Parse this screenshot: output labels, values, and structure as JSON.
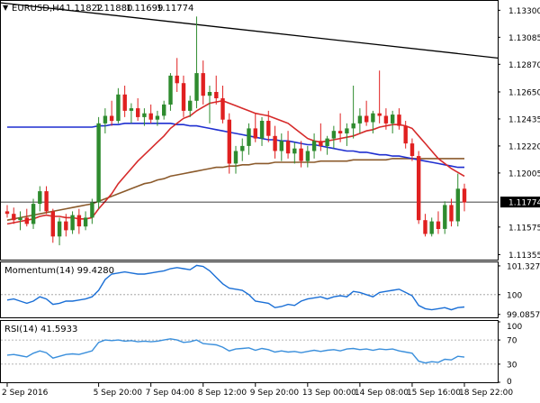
{
  "chart_data": {
    "type": "candlestick",
    "symbol_title": "EURUSD,H4",
    "ohlc": [
      "1.11822",
      "1.11880",
      "1.11699",
      "1.11774"
    ],
    "price_axis": {
      "min": 1.1133,
      "max": 1.1336,
      "ticks": [
        "1.13300",
        "1.13085",
        "1.12870",
        "1.12650",
        "1.12435",
        "1.12220",
        "1.12005",
        "1.11575",
        "1.11355"
      ],
      "current_price": 1.11774,
      "current_price_label": "1.11774"
    },
    "time_axis": {
      "labels": [
        {
          "text": "2 Sep 2016",
          "index": 0
        },
        {
          "text": "5 Sep 20:00",
          "index": 14
        },
        {
          "text": "7 Sep 04:00",
          "index": 22
        },
        {
          "text": "8 Sep 12:00",
          "index": 30
        },
        {
          "text": "9 Sep 20:00",
          "index": 38
        },
        {
          "text": "13 Sep 00:00",
          "index": 46
        },
        {
          "text": "14 Sep 08:00",
          "index": 54
        },
        {
          "text": "15 Sep 16:00",
          "index": 62
        },
        {
          "text": "18 Sep 22:00",
          "index": 70
        }
      ]
    },
    "candles": [
      [
        1.117,
        1.1175,
        1.1165,
        1.1168
      ],
      [
        1.1168,
        1.1173,
        1.116,
        1.1163
      ],
      [
        1.1163,
        1.117,
        1.1155,
        1.1165
      ],
      [
        1.1165,
        1.1172,
        1.1158,
        1.116
      ],
      [
        1.116,
        1.118,
        1.1156,
        1.1176
      ],
      [
        1.1176,
        1.119,
        1.117,
        1.1186
      ],
      [
        1.1186,
        1.119,
        1.1168,
        1.117
      ],
      [
        1.117,
        1.1172,
        1.1145,
        1.115
      ],
      [
        1.115,
        1.1165,
        1.1143,
        1.1162
      ],
      [
        1.1162,
        1.1168,
        1.115,
        1.1155
      ],
      [
        1.1155,
        1.117,
        1.1152,
        1.1167
      ],
      [
        1.1167,
        1.1172,
        1.1152,
        1.1158
      ],
      [
        1.1158,
        1.117,
        1.1155,
        1.1165
      ],
      [
        1.1165,
        1.118,
        1.116,
        1.1177
      ],
      [
        1.1177,
        1.1245,
        1.1172,
        1.124
      ],
      [
        1.124,
        1.1252,
        1.1232,
        1.1246
      ],
      [
        1.1246,
        1.1258,
        1.1238,
        1.1242
      ],
      [
        1.1242,
        1.1268,
        1.124,
        1.1263
      ],
      [
        1.1263,
        1.127,
        1.1245,
        1.125
      ],
      [
        1.125,
        1.1256,
        1.124,
        1.1252
      ],
      [
        1.1252,
        1.126,
        1.1242,
        1.1245
      ],
      [
        1.1245,
        1.1252,
        1.1238,
        1.1248
      ],
      [
        1.1248,
        1.1255,
        1.124,
        1.1243
      ],
      [
        1.1243,
        1.125,
        1.1238,
        1.1246
      ],
      [
        1.1246,
        1.1258,
        1.1243,
        1.1255
      ],
      [
        1.1255,
        1.128,
        1.125,
        1.1278
      ],
      [
        1.1278,
        1.1292,
        1.1265,
        1.1272
      ],
      [
        1.1272,
        1.1278,
        1.1245,
        1.125
      ],
      [
        1.125,
        1.1262,
        1.1245,
        1.1258
      ],
      [
        1.1258,
        1.1325,
        1.1252,
        1.128
      ],
      [
        1.128,
        1.129,
        1.1255,
        1.1262
      ],
      [
        1.1262,
        1.127,
        1.124,
        1.1265
      ],
      [
        1.1265,
        1.1278,
        1.1255,
        1.126
      ],
      [
        1.126,
        1.127,
        1.124,
        1.1243
      ],
      [
        1.1243,
        1.1248,
        1.12,
        1.1208
      ],
      [
        1.1208,
        1.1222,
        1.12,
        1.1218
      ],
      [
        1.1218,
        1.1228,
        1.121,
        1.1222
      ],
      [
        1.1222,
        1.124,
        1.1215,
        1.1236
      ],
      [
        1.1236,
        1.1248,
        1.1225,
        1.1228
      ],
      [
        1.1228,
        1.1245,
        1.1222,
        1.1242
      ],
      [
        1.1242,
        1.125,
        1.1225,
        1.123
      ],
      [
        1.123,
        1.1238,
        1.1212,
        1.1218
      ],
      [
        1.1218,
        1.1232,
        1.121,
        1.1226
      ],
      [
        1.1226,
        1.1234,
        1.1212,
        1.1216
      ],
      [
        1.1216,
        1.1225,
        1.1208,
        1.122
      ],
      [
        1.122,
        1.1226,
        1.1205,
        1.121
      ],
      [
        1.121,
        1.1222,
        1.1205,
        1.1218
      ],
      [
        1.1218,
        1.1232,
        1.1212,
        1.1226
      ],
      [
        1.1226,
        1.124,
        1.1218,
        1.1222
      ],
      [
        1.1222,
        1.123,
        1.1215,
        1.1228
      ],
      [
        1.1228,
        1.1238,
        1.122,
        1.1234
      ],
      [
        1.1234,
        1.1248,
        1.1225,
        1.1232
      ],
      [
        1.1232,
        1.124,
        1.1222,
        1.1236
      ],
      [
        1.1236,
        1.127,
        1.1228,
        1.124
      ],
      [
        1.124,
        1.1252,
        1.1232,
        1.1246
      ],
      [
        1.1246,
        1.1258,
        1.1238,
        1.1241
      ],
      [
        1.1241,
        1.125,
        1.1232,
        1.1248
      ],
      [
        1.1248,
        1.1282,
        1.124,
        1.1246
      ],
      [
        1.1246,
        1.1252,
        1.1235,
        1.124
      ],
      [
        1.124,
        1.125,
        1.1232,
        1.1247
      ],
      [
        1.1247,
        1.1252,
        1.1235,
        1.1238
      ],
      [
        1.1238,
        1.1242,
        1.122,
        1.1224
      ],
      [
        1.1224,
        1.1228,
        1.121,
        1.1214
      ],
      [
        1.1214,
        1.1218,
        1.116,
        1.1163
      ],
      [
        1.1163,
        1.1168,
        1.115,
        1.1152
      ],
      [
        1.1152,
        1.1165,
        1.115,
        1.1162
      ],
      [
        1.1162,
        1.117,
        1.1152,
        1.1156
      ],
      [
        1.1156,
        1.1178,
        1.1152,
        1.1175
      ],
      [
        1.1175,
        1.118,
        1.1158,
        1.1162
      ],
      [
        1.1162,
        1.12,
        1.1158,
        1.1188
      ],
      [
        1.1188,
        1.1192,
        1.117,
        1.1177
      ]
    ],
    "overlays": {
      "ma_red": [
        1.116,
        1.1161,
        1.1162,
        1.1163,
        1.1164,
        1.1166,
        1.1167,
        1.1166,
        1.1166,
        1.1165,
        1.1165,
        1.1164,
        1.1164,
        1.1165,
        1.1172,
        1.1178,
        1.1184,
        1.1192,
        1.1198,
        1.1204,
        1.121,
        1.1215,
        1.122,
        1.1225,
        1.123,
        1.1236,
        1.124,
        1.1244,
        1.1246,
        1.125,
        1.1253,
        1.1256,
        1.1257,
        1.1258,
        1.1256,
        1.1254,
        1.1252,
        1.125,
        1.1248,
        1.1247,
        1.1246,
        1.1244,
        1.1242,
        1.124,
        1.1236,
        1.1232,
        1.1228,
        1.1226,
        1.1225,
        1.1226,
        1.1227,
        1.1228,
        1.1229,
        1.123,
        1.1232,
        1.1234,
        1.1235,
        1.1237,
        1.1238,
        1.1239,
        1.1239,
        1.1238,
        1.1236,
        1.123,
        1.1224,
        1.1218,
        1.1212,
        1.1208,
        1.1204,
        1.1201,
        1.1198
      ],
      "ma_brown": [
        1.1163,
        1.1164,
        1.1165,
        1.1166,
        1.1167,
        1.1168,
        1.1169,
        1.117,
        1.1171,
        1.1172,
        1.1173,
        1.1174,
        1.1175,
        1.1176,
        1.1178,
        1.118,
        1.1182,
        1.1184,
        1.1186,
        1.1188,
        1.119,
        1.1192,
        1.1193,
        1.1195,
        1.1196,
        1.1198,
        1.1199,
        1.12,
        1.1201,
        1.1202,
        1.1203,
        1.1204,
        1.1205,
        1.1205,
        1.1206,
        1.1206,
        1.1207,
        1.1207,
        1.1208,
        1.1208,
        1.1208,
        1.1209,
        1.1209,
        1.1209,
        1.1209,
        1.1209,
        1.1209,
        1.1209,
        1.121,
        1.121,
        1.121,
        1.121,
        1.121,
        1.1211,
        1.1211,
        1.1211,
        1.1211,
        1.1211,
        1.1211,
        1.1212,
        1.1212,
        1.1212,
        1.1212,
        1.1212,
        1.1212,
        1.1212,
        1.1212,
        1.1212,
        1.1212,
        1.1212,
        1.1212
      ],
      "ma_blue": [
        1.1237,
        1.1237,
        1.1237,
        1.1237,
        1.1237,
        1.1237,
        1.1237,
        1.1237,
        1.1237,
        1.1237,
        1.1237,
        1.1237,
        1.1237,
        1.1237,
        1.1238,
        1.1238,
        1.1239,
        1.1239,
        1.124,
        1.124,
        1.124,
        1.124,
        1.124,
        1.124,
        1.124,
        1.124,
        1.1239,
        1.1239,
        1.1238,
        1.1238,
        1.1237,
        1.1236,
        1.1235,
        1.1234,
        1.1233,
        1.1232,
        1.1231,
        1.123,
        1.1229,
        1.1228,
        1.1227,
        1.1227,
        1.1226,
        1.1226,
        1.1225,
        1.1224,
        1.1223,
        1.1223,
        1.1222,
        1.1221,
        1.122,
        1.1219,
        1.1218,
        1.1218,
        1.1217,
        1.1217,
        1.1216,
        1.1215,
        1.1215,
        1.1214,
        1.1214,
        1.1213,
        1.1212,
        1.1211,
        1.121,
        1.1209,
        1.1208,
        1.1207,
        1.1206,
        1.1205,
        1.1205
      ],
      "trendline": {
        "start": 1.1336,
        "end": 1.1292
      }
    },
    "momentum": {
      "title": "Momentum(14) 99.4280",
      "min": 98.95,
      "max": 101.45,
      "ticks": [
        "101.3274",
        "100",
        "99.0857"
      ],
      "levels": [
        100
      ],
      "values": [
        99.75,
        99.8,
        99.7,
        99.6,
        99.7,
        99.9,
        99.8,
        99.55,
        99.6,
        99.7,
        99.7,
        99.75,
        99.8,
        99.9,
        100.2,
        100.7,
        100.95,
        101.0,
        101.05,
        101.0,
        100.95,
        100.95,
        101.0,
        101.05,
        101.1,
        101.2,
        101.25,
        101.2,
        101.15,
        101.35,
        101.3,
        101.1,
        100.8,
        100.5,
        100.3,
        100.25,
        100.2,
        100.0,
        99.7,
        99.65,
        99.6,
        99.4,
        99.45,
        99.55,
        99.5,
        99.7,
        99.8,
        99.85,
        99.9,
        99.8,
        99.9,
        99.95,
        99.9,
        100.15,
        100.1,
        100.0,
        99.9,
        100.1,
        100.15,
        100.2,
        100.25,
        100.1,
        99.95,
        99.5,
        99.35,
        99.3,
        99.35,
        99.4,
        99.3,
        99.4,
        99.43
      ]
    },
    "rsi": {
      "title": "RSI(14) 41.5933",
      "min": 0,
      "max": 100,
      "ticks": [
        "100",
        "70",
        "30",
        "0"
      ],
      "levels": [
        70,
        30
      ],
      "values": [
        45,
        46,
        44,
        42,
        48,
        52,
        49,
        40,
        43,
        46,
        47,
        46,
        49,
        52,
        66,
        70,
        69,
        70,
        68,
        69,
        67,
        68,
        67,
        68,
        70,
        72,
        70,
        66,
        67,
        70,
        64,
        63,
        62,
        58,
        52,
        55,
        56,
        57,
        53,
        56,
        54,
        50,
        52,
        50,
        51,
        49,
        51,
        53,
        51,
        53,
        54,
        52,
        55,
        56,
        54,
        55,
        53,
        55,
        54,
        55,
        52,
        50,
        48,
        35,
        32,
        34,
        33,
        38,
        37,
        43,
        41.59
      ]
    }
  }
}
